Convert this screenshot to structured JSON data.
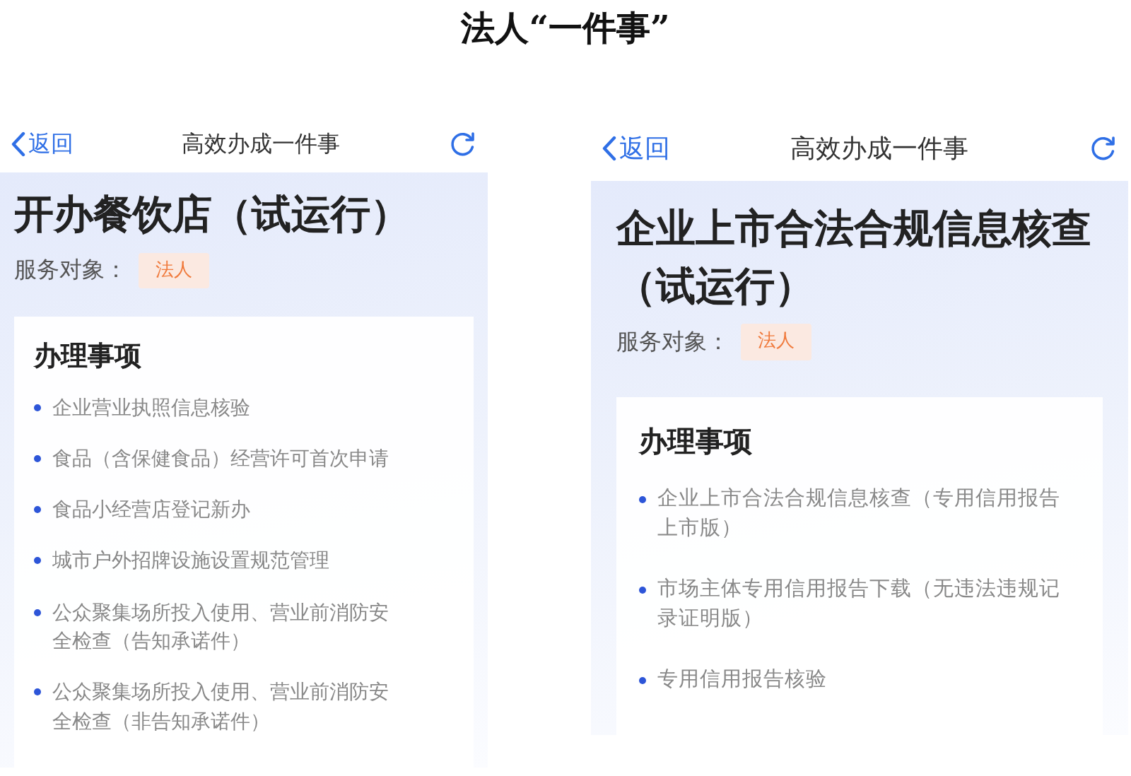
{
  "caption": "法人“一件事”",
  "phones": [
    {
      "nav": {
        "back": "返回",
        "title": "高效办成一件事"
      },
      "title": "开办餐饮店（试运行）",
      "service_label": "服务对象：",
      "service_tag": "法人",
      "section_title": "办理事项",
      "items": [
        "企业营业执照信息核验",
        "食品（含保健食品）经营许可首次申请",
        "食品小经营店登记新办",
        "城市户外招牌设施设置规范管理",
        "公众聚集场所投入使用、营业前消防安全检查（告知承诺件）",
        "公众聚集场所投入使用、营业前消防安全检查（非告知承诺件）"
      ]
    },
    {
      "nav": {
        "back": "返回",
        "title": "高效办成一件事"
      },
      "title": "企业上市合法合规信息核查（试运行）",
      "service_label": "服务对象：",
      "service_tag": "法人",
      "section_title": "办理事项",
      "items": [
        "企业上市合法合规信息核查（专用信用报告上市版）",
        "市场主体专用信用报告下载（无违法违规记录证明版）",
        "专用信用报告核验"
      ]
    }
  ]
}
